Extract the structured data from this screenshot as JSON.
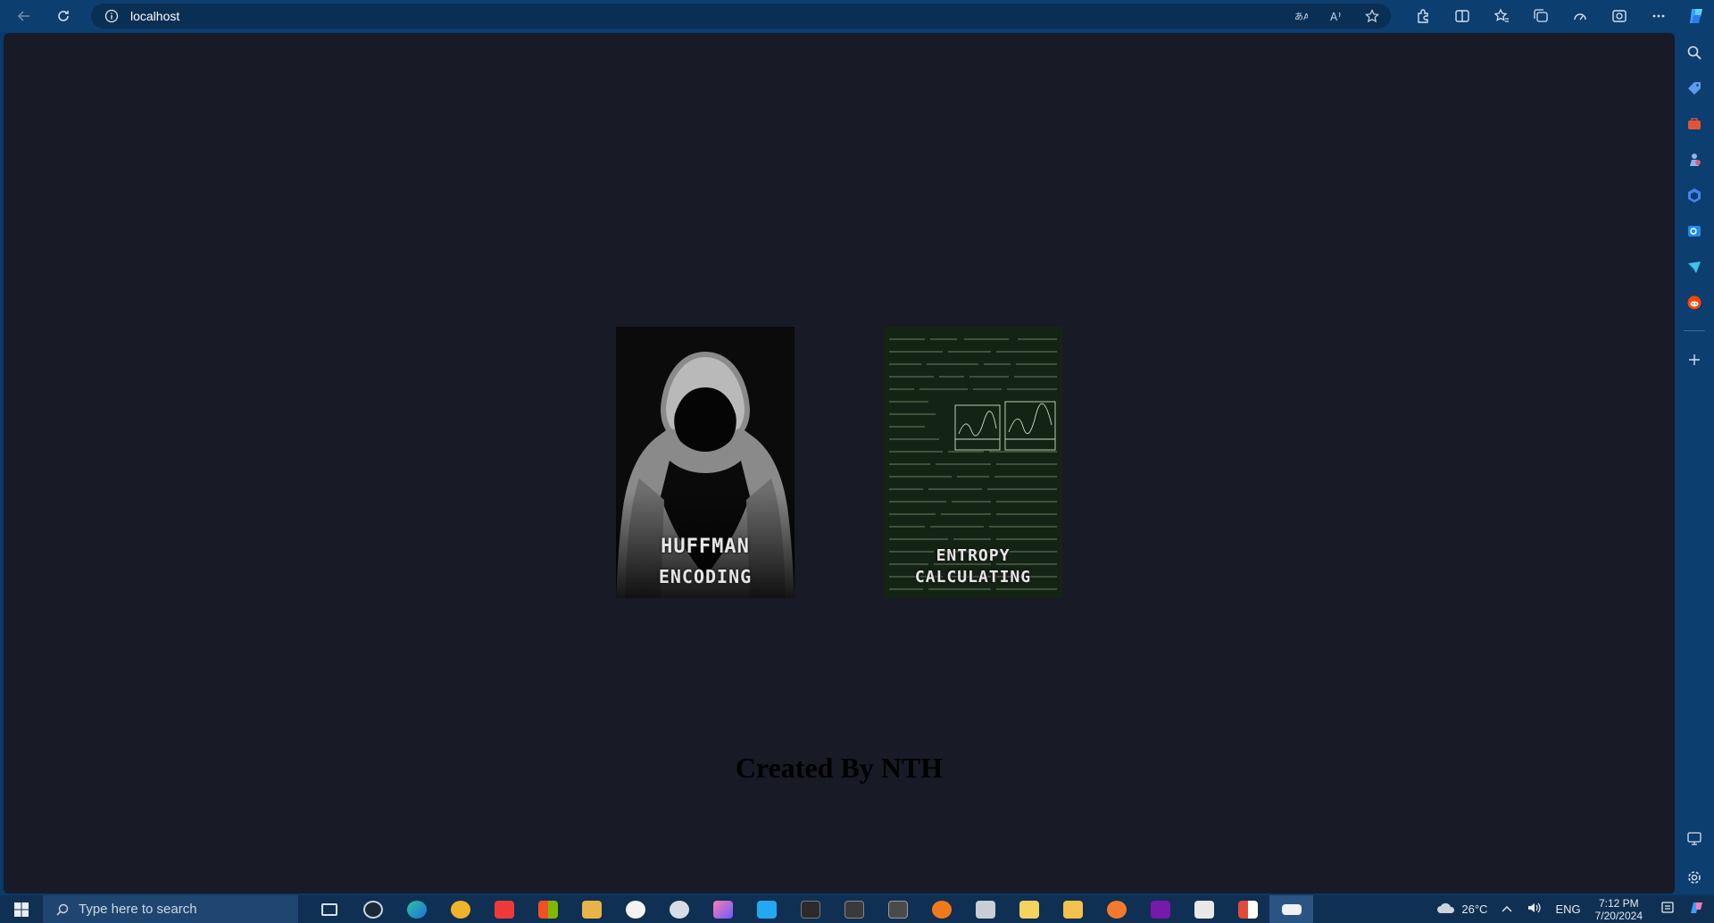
{
  "browser": {
    "url": "localhost"
  },
  "page": {
    "cards": [
      {
        "line1": "HUFFMAN",
        "line2": "ENCODING"
      },
      {
        "line1": "ENTROPY",
        "line2": "CALCULATING"
      }
    ],
    "footer": "Created By NTH"
  },
  "taskbar": {
    "search_placeholder": "Type here to search",
    "weather": "26°C",
    "language": "ENG",
    "time": "7:12 PM",
    "date": "7/20/2024"
  },
  "colors": {
    "page_bg": "#181a26",
    "chrome": "#0c3e6f"
  }
}
